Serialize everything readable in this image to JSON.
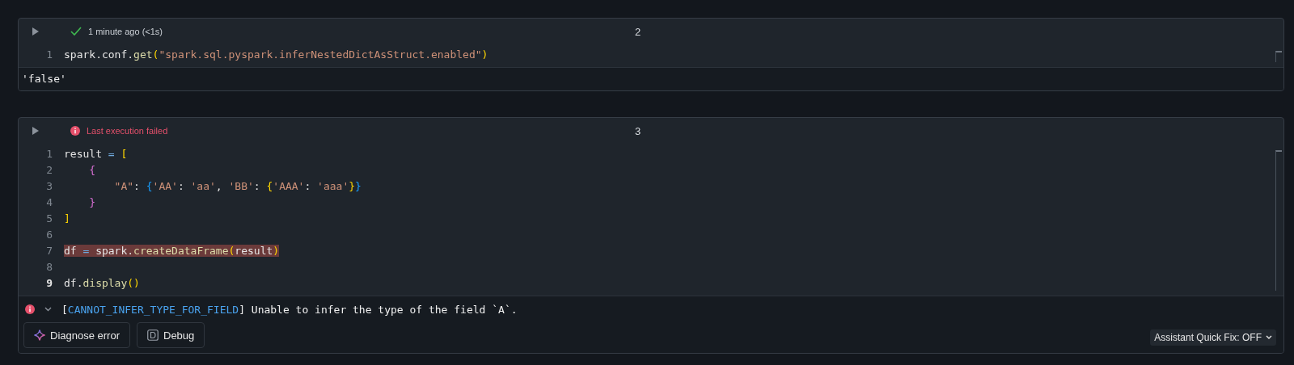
{
  "cells": [
    {
      "number": "2",
      "status": {
        "kind": "success",
        "text": "1 minute ago (<1s)"
      },
      "code": [
        {
          "number": "1",
          "current": false,
          "highlighted": false,
          "tokens": [
            {
              "kind": "plain",
              "text": "spark.conf."
            },
            {
              "kind": "func",
              "text": "get"
            },
            {
              "kind": "bracket1",
              "text": "("
            },
            {
              "kind": "string",
              "text": "\"spark.sql.pyspark.inferNestedDictAsStruct.enabled\""
            },
            {
              "kind": "bracket1",
              "text": ")"
            }
          ]
        }
      ],
      "output": {
        "kind": "text",
        "text": "'false'"
      }
    },
    {
      "number": "3",
      "status": {
        "kind": "failed",
        "text": "Last execution failed"
      },
      "code": [
        {
          "number": "1",
          "current": false,
          "highlighted": false,
          "tokens": [
            {
              "kind": "plain",
              "text": "result"
            },
            {
              "kind": "op",
              "text": " = "
            },
            {
              "kind": "bracket1",
              "text": "["
            }
          ]
        },
        {
          "number": "2",
          "current": false,
          "highlighted": false,
          "tokens": [
            {
              "kind": "bracket2",
              "text": "    {"
            }
          ]
        },
        {
          "number": "3",
          "current": false,
          "highlighted": false,
          "tokens": [
            {
              "kind": "string",
              "text": "        \"A\""
            },
            {
              "kind": "plain",
              "text": ": "
            },
            {
              "kind": "bracket3",
              "text": "{"
            },
            {
              "kind": "string",
              "text": "'AA'"
            },
            {
              "kind": "plain",
              "text": ": "
            },
            {
              "kind": "string",
              "text": "'aa'"
            },
            {
              "kind": "plain",
              "text": ", "
            },
            {
              "kind": "string",
              "text": "'BB'"
            },
            {
              "kind": "plain",
              "text": ": "
            },
            {
              "kind": "bracket1",
              "text": "{"
            },
            {
              "kind": "string",
              "text": "'AAA'"
            },
            {
              "kind": "plain",
              "text": ": "
            },
            {
              "kind": "string",
              "text": "'aaa'"
            },
            {
              "kind": "bracket1",
              "text": "}"
            },
            {
              "kind": "bracket3",
              "text": "}"
            }
          ]
        },
        {
          "number": "4",
          "current": false,
          "highlighted": false,
          "tokens": [
            {
              "kind": "bracket2",
              "text": "    }"
            }
          ]
        },
        {
          "number": "5",
          "current": false,
          "highlighted": false,
          "tokens": [
            {
              "kind": "bracket1",
              "text": "]"
            }
          ]
        },
        {
          "number": "6",
          "current": false,
          "highlighted": false
        },
        {
          "number": "7",
          "current": false,
          "highlighted": true,
          "tokens": [
            {
              "kind": "plain",
              "text": "df"
            },
            {
              "kind": "op",
              "text": " = "
            },
            {
              "kind": "plain",
              "text": "spark."
            },
            {
              "kind": "func",
              "text": "createDataFrame"
            },
            {
              "kind": "bracket1",
              "text": "("
            },
            {
              "kind": "plain",
              "text": "result"
            },
            {
              "kind": "bracket1",
              "text": ")"
            }
          ]
        },
        {
          "number": "8",
          "current": false,
          "highlighted": false
        },
        {
          "number": "9",
          "current": true,
          "highlighted": false,
          "tokens": [
            {
              "kind": "plain",
              "text": "df."
            },
            {
              "kind": "func",
              "text": "display"
            },
            {
              "kind": "bracket1",
              "text": "()"
            }
          ]
        }
      ],
      "output": {
        "kind": "error",
        "expanded": true,
        "before": "[",
        "code": "CANNOT_INFER_TYPE_FOR_FIELD",
        "after": "] Unable to infer the type of the field `A`.",
        "buttons": [
          {
            "kind": "sparkle",
            "label": "Diagnose error"
          },
          {
            "kind": "debug",
            "label": "Debug"
          }
        ],
        "quick_fix": "Assistant Quick Fix: OFF"
      }
    }
  ]
}
